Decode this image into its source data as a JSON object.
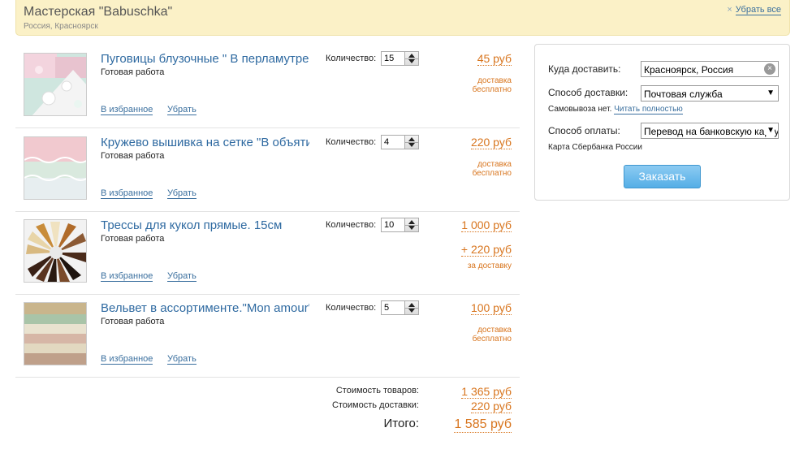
{
  "shop": {
    "name": "Мастерская \"Babuschka\"",
    "location": "Россия, Красноярск",
    "remove_all": "Убрать все"
  },
  "items": [
    {
      "title": "Пуговицы блузочные \" В перламутре",
      "subtitle": "Готовая работа",
      "qty_label": "Количество:",
      "qty": "15",
      "price": "45 руб",
      "shipping": "доставка бесплатно",
      "fav": "В избранное",
      "remove": "Убрать"
    },
    {
      "title": "Кружево вышивка на сетке \"В объятиях",
      "subtitle": "Готовая работа",
      "qty_label": "Количество:",
      "qty": "4",
      "price": "220 руб",
      "shipping": "доставка бесплатно",
      "fav": "В избранное",
      "remove": "Убрать"
    },
    {
      "title": "Трессы для кукол прямые. 15см",
      "subtitle": "Готовая работа",
      "qty_label": "Количество:",
      "qty": "10",
      "price": "1 000 руб",
      "shipping_cost": "+ 220 руб",
      "shipping_note": "за доставку",
      "fav": "В избранное",
      "remove": "Убрать"
    },
    {
      "title": "Вельвет в ассортименте.\"Mon amour\"",
      "subtitle": "Готовая работа",
      "qty_label": "Количество:",
      "qty": "5",
      "price": "100 руб",
      "shipping": "доставка бесплатно",
      "fav": "В избранное",
      "remove": "Убрать"
    }
  ],
  "totals": {
    "goods_label": "Стоимость товаров:",
    "goods_value": "1 365 руб",
    "delivery_label": "Стоимость доставки:",
    "delivery_value": "220 руб",
    "total_label": "Итого:",
    "total_value": "1 585 руб"
  },
  "order": {
    "deliver_to_label": "Куда доставить:",
    "deliver_to_value": "Красноярск, Россия",
    "method_label": "Способ доставки:",
    "method_value": "Почтовая служба",
    "pickup_note": "Самовывоза нет.",
    "read_more": "Читать полностью",
    "payment_label": "Способ оплаты:",
    "payment_value": "Перевод на банковскую карту",
    "payment_note": "Карта Сбербанка России",
    "submit": "Заказать"
  },
  "icons": {
    "close": "×",
    "clear": "×",
    "dropdown": "▼"
  },
  "colors": {
    "accent_orange": "#d8751e",
    "link_blue": "#2f6aa1",
    "header_bg": "#fbf1c7",
    "button_blue": "#55aee6"
  }
}
